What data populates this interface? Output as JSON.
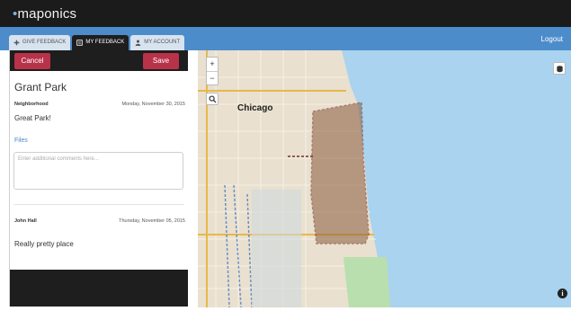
{
  "app": {
    "logo_text": "maponics"
  },
  "tabs": [
    {
      "label": "Give Feedback",
      "icon": "plus-icon"
    },
    {
      "label": "My Feedback",
      "icon": "list-icon"
    },
    {
      "label": "My Account",
      "icon": "user-icon"
    }
  ],
  "header": {
    "logout": "Logout"
  },
  "panel": {
    "cancel_label": "Cancel",
    "save_label": "Save",
    "place_title": "Grant Park",
    "entry": {
      "type": "Neighborhood",
      "date": "Monday, November 30, 2015",
      "comment": "Great Park!"
    },
    "files_label": "Files",
    "comment_placeholder": "Enter additional comments here...",
    "reply": {
      "author": "John Hall",
      "date": "Thursday, November 05, 2015",
      "comment": "Really pretty place"
    }
  },
  "map": {
    "city_label": "Chicago",
    "zoom_in": "+",
    "zoom_out": "−",
    "info": "i",
    "colors": {
      "water": "#a9d3ee",
      "land": "#e9e0cf",
      "park": "#b9dfae",
      "highlight": "#8a5d3c"
    }
  }
}
